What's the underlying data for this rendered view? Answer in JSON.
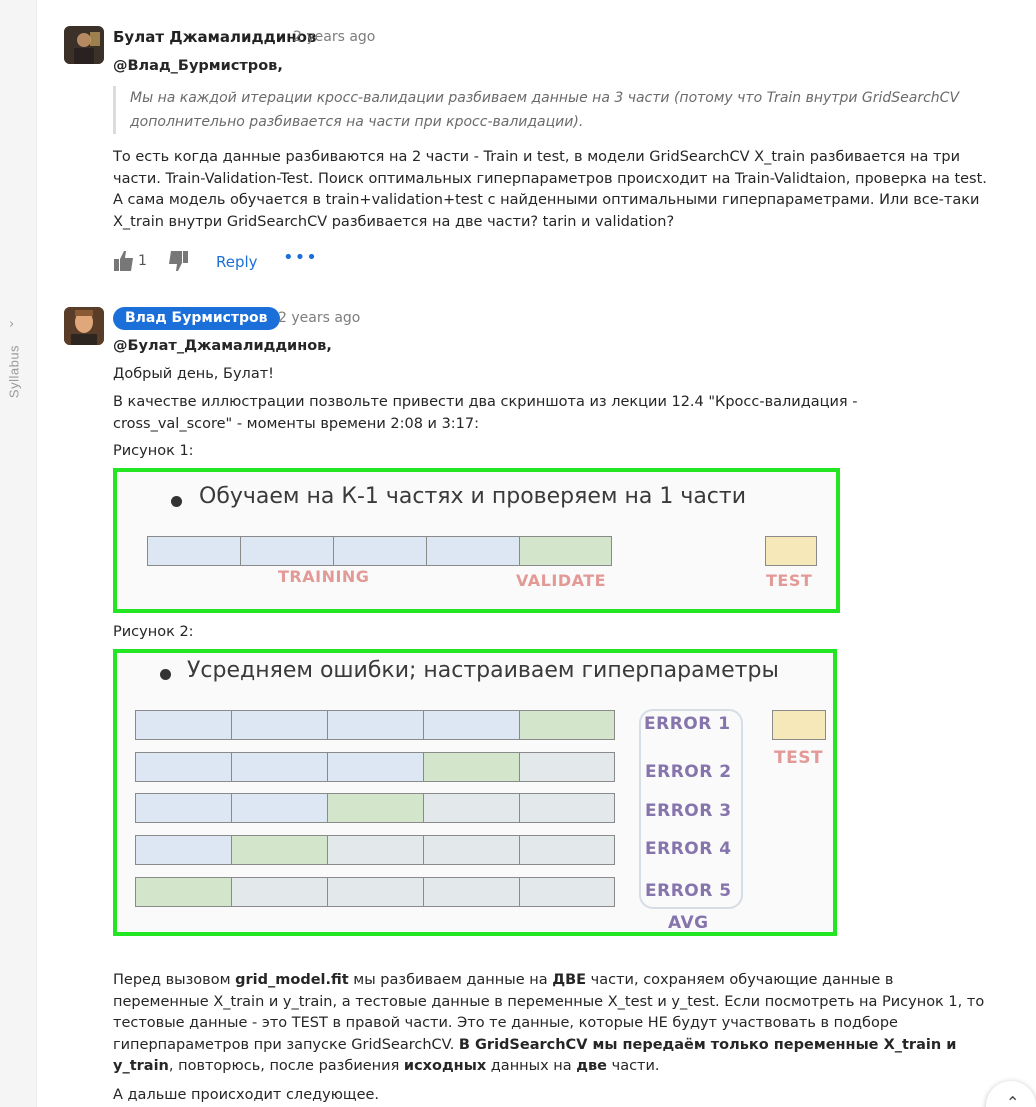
{
  "sidebar": {
    "syllabus_label": "Syllabus"
  },
  "comment1": {
    "author": "Булат Джамалиддинов",
    "time": "2 years ago",
    "mention": "@Влад_Бурмистров",
    "quote": "Мы на каждой итерации кросс-валидации разбиваем данные на 3 части (потому что Train внутри GridSearchCV дополнительно разбивается на части при кросс-валидации).",
    "body": "То есть когда данные разбиваются на 2 части - Train и test, в модели GridSearchCV X_train разбивается на три части. Train-Validation-Test. Поиск оптимальных гиперпараметров происходит на Train-Validtaion, проверка на test.  А сама модель обучается в train+validation+test с найденными оптимальными гиперпараметрами. Или все-таки X_train внутри GridSearchCV разбивается на две части? tarin и validation?",
    "likes": "1",
    "reply_label": "Reply",
    "more_label": "•••"
  },
  "comment2": {
    "author": "Влад Бурмистров",
    "time": "2 years ago",
    "mention": "@Булат_Джамалиддинов",
    "greeting": "Добрый день, Булат!",
    "intro": "В качестве иллюстрации позвольте привести два скриншота из лекции 12.4 \"Кросс-валидация - cross_val_score\" - моменты времени 2:08 и 3:17:",
    "figure1_caption": "Рисунок 1:",
    "figure2_caption": "Рисунок 2:",
    "p1_a": "Перед вызовом ",
    "p1_b": "grid_model.fit",
    "p1_c": " мы разбиваем данные на ",
    "p1_d": "ДВЕ",
    "p1_e": " части, сохраняем обучающие данные в переменные X_train и y_train, а тестовые данные в переменные X_test и y_test.  Если посмотреть на Рисунок 1, то тестовые данные - это TEST в правой части. Это те данные, которые НЕ будут участвовать в подборе гиперпараметров при запуске GridSearchCV.  ",
    "p1_f": "В GridSearchCV мы передаём только переменные X_train и y_train",
    "p1_g": ", повторюсь, после разбиения ",
    "p1_h": "исходных",
    "p1_i": " данных на ",
    "p1_j": "две",
    "p1_k": " части.",
    "last_line": "А дальше происходит следующее."
  },
  "figure1": {
    "title": "Обучаем на К-1 частях и проверяем на 1 части",
    "training_label": "TRAINING",
    "validate_label": "VALIDATE",
    "test_label": "TEST"
  },
  "figure2": {
    "title": "Усредняем ошибки; настраиваем гиперпараметры",
    "errors": [
      "ERROR 1",
      "ERROR 2",
      "ERROR 3",
      "ERROR 4",
      "ERROR 5"
    ],
    "avg_label": "AVG",
    "test_label": "TEST"
  },
  "colors": {
    "accent": "#1b6fd9",
    "figure_border": "#22e622",
    "training": "#dde7f3",
    "validate": "#d3e5cb",
    "other": "#e3e8eb",
    "test": "#f7e8b9"
  }
}
